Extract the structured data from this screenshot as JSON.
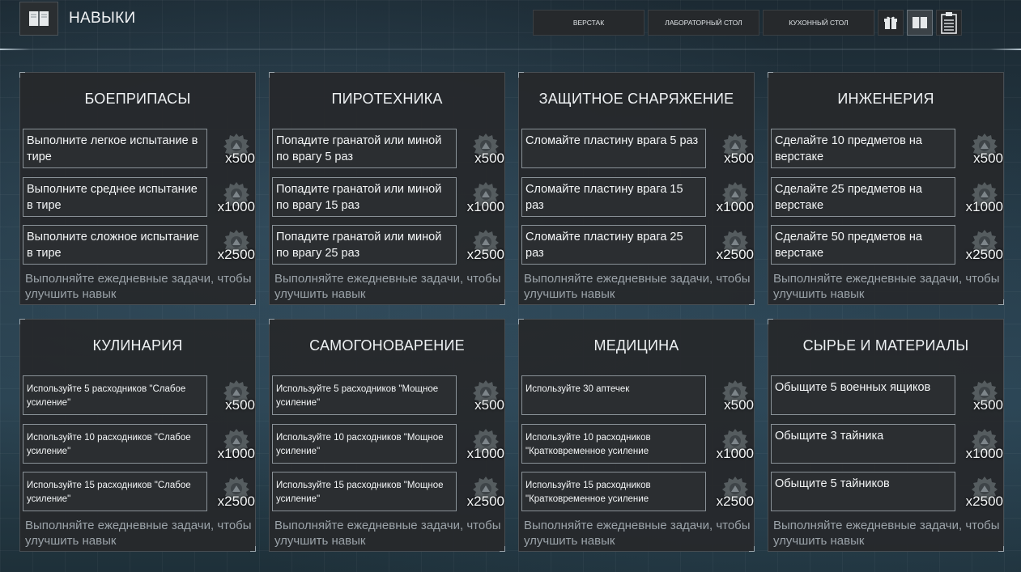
{
  "header": {
    "title": "НАВЫКИ",
    "tabs": [
      "ВЕРСТАК",
      "ЛАБОРАТОРНЫЙ СТОЛ",
      "КУХОННЫЙ СТОЛ"
    ],
    "icons": [
      "gift-icon",
      "book-icon",
      "clipboard-icon"
    ],
    "active_icon": "book-icon"
  },
  "colors": {
    "card_bg": "#26292c",
    "task_border": "#8a9298",
    "note": "#9ba3a9"
  },
  "skills": [
    {
      "title": "БОЕПРИПАСЫ",
      "tasks": [
        {
          "text": "Выполните легкое испытание в тире",
          "reward": "x500"
        },
        {
          "text": "Выполните среднее испытание в тире",
          "reward": "x1000"
        },
        {
          "text": "Выполните сложное испытание в тире",
          "reward": "x2500"
        }
      ],
      "note": "Выполняйте ежедневные задачи, чтобы улучшить навык"
    },
    {
      "title": "ПИРОТЕХНИКА",
      "tasks": [
        {
          "text": "Попадите гранатой или миной по врагу 5 раз",
          "reward": "x500"
        },
        {
          "text": "Попадите гранатой или миной по врагу 15 раз",
          "reward": "x1000"
        },
        {
          "text": "Попадите гранатой или миной по врагу 25 раз",
          "reward": "x2500"
        }
      ],
      "note": "Выполняйте ежедневные задачи, чтобы улучшить навык"
    },
    {
      "title": "ЗАЩИТНОЕ СНАРЯЖЕНИЕ",
      "tasks": [
        {
          "text": "Сломайте пластину врага 5 раз",
          "reward": "x500"
        },
        {
          "text": "Сломайте пластину врага 15 раз",
          "reward": "x1000"
        },
        {
          "text": "Сломайте пластину врага 25 раз",
          "reward": "x2500"
        }
      ],
      "note": "Выполняйте ежедневные задачи, чтобы улучшить навык"
    },
    {
      "title": "ИНЖЕНЕРИЯ",
      "tasks": [
        {
          "text": "Сделайте 10 предметов на верстаке",
          "reward": "x500"
        },
        {
          "text": "Сделайте 25 предметов на верстаке",
          "reward": "x1000"
        },
        {
          "text": "Сделайте 50 предметов на верстаке",
          "reward": "x2500"
        }
      ],
      "note": "Выполняйте ежедневные задачи, чтобы улучшить навык"
    },
    {
      "title": "КУЛИНАРИЯ",
      "tasks": [
        {
          "text": "Используйте 5 расходников \"Слабое усиление\"",
          "reward": "x500"
        },
        {
          "text": "Используйте 10 расходников \"Слабое усиление\"",
          "reward": "x1000"
        },
        {
          "text": "Используйте 15 расходников \"Слабое усиление\"",
          "reward": "x2500"
        }
      ],
      "note": "Выполняйте ежедневные задачи, чтобы улучшить навык"
    },
    {
      "title": "САМОГОНОВАРЕНИЕ",
      "tasks": [
        {
          "text": "Используйте 5 расходников \"Мощное усиление\"",
          "reward": "x500"
        },
        {
          "text": "Используйте 10 расходников \"Мощное усиление\"",
          "reward": "x1000"
        },
        {
          "text": "Используйте 15 расходников \"Мощное усиление\"",
          "reward": "x2500"
        }
      ],
      "note": "Выполняйте ежедневные задачи, чтобы улучшить навык"
    },
    {
      "title": "МЕДИЦИНА",
      "tasks": [
        {
          "text": "Используйте 30 аптечек",
          "reward": "x500"
        },
        {
          "text": "Используйте 10 расходников \"Кратковременное усиление",
          "reward": "x1000"
        },
        {
          "text": "Используйте 15 расходников \"Кратковременное усиление",
          "reward": "x2500"
        }
      ],
      "note": "Выполняйте ежедневные задачи, чтобы улучшить навык"
    },
    {
      "title": "СЫРЬЕ И МАТЕРИАЛЫ",
      "tasks": [
        {
          "text": "Обыщите 5 военных ящиков",
          "reward": "x500"
        },
        {
          "text": "Обыщите 3 тайника",
          "reward": "x1000"
        },
        {
          "text": "Обыщите 5 тайников",
          "reward": "x2500"
        }
      ],
      "note": "Выполняйте ежедневные задачи, чтобы улучшить навык"
    }
  ]
}
